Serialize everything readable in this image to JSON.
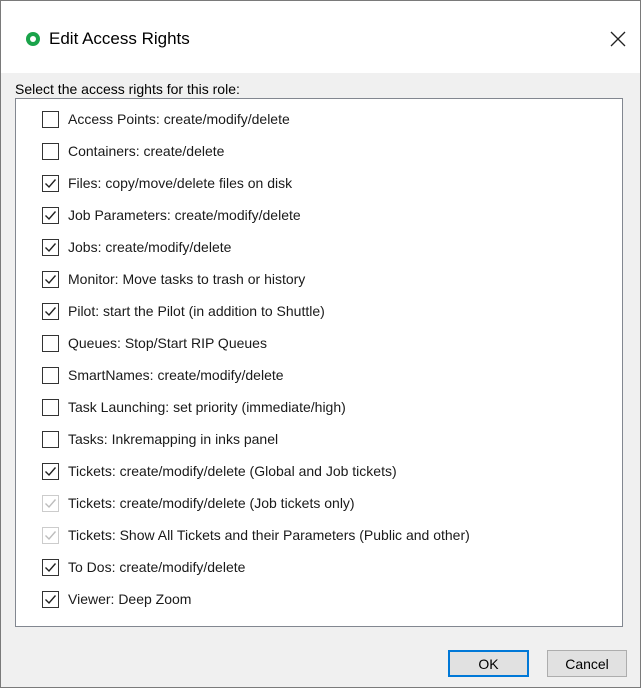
{
  "dialog": {
    "title": "Edit Access Rights",
    "icon": "app-circle-icon",
    "close": "close-icon"
  },
  "prompt": "Select the access rights for this role:",
  "rights": [
    {
      "label": "Access Points: create/modify/delete",
      "checked": false,
      "enabled": true
    },
    {
      "label": "Containers: create/delete",
      "checked": false,
      "enabled": true
    },
    {
      "label": "Files: copy/move/delete files on disk",
      "checked": true,
      "enabled": true
    },
    {
      "label": "Job Parameters: create/modify/delete",
      "checked": true,
      "enabled": true
    },
    {
      "label": "Jobs: create/modify/delete",
      "checked": true,
      "enabled": true
    },
    {
      "label": "Monitor: Move tasks to trash or history",
      "checked": true,
      "enabled": true
    },
    {
      "label": "Pilot: start the Pilot (in addition to Shuttle)",
      "checked": true,
      "enabled": true
    },
    {
      "label": "Queues: Stop/Start RIP Queues",
      "checked": false,
      "enabled": true
    },
    {
      "label": "SmartNames: create/modify/delete",
      "checked": false,
      "enabled": true
    },
    {
      "label": "Task Launching: set priority (immediate/high)",
      "checked": false,
      "enabled": true
    },
    {
      "label": "Tasks: Inkremapping in inks panel",
      "checked": false,
      "enabled": true
    },
    {
      "label": "Tickets: create/modify/delete (Global and Job tickets)",
      "checked": true,
      "enabled": true
    },
    {
      "label": "Tickets: create/modify/delete (Job tickets only)",
      "checked": true,
      "enabled": false
    },
    {
      "label": "Tickets: Show All Tickets and their Parameters (Public and other)",
      "checked": true,
      "enabled": false
    },
    {
      "label": "To Dos: create/modify/delete",
      "checked": true,
      "enabled": true
    },
    {
      "label": "Viewer: Deep Zoom",
      "checked": true,
      "enabled": true
    }
  ],
  "buttons": {
    "ok": "OK",
    "cancel": "Cancel"
  },
  "colors": {
    "accent": "#0078d7",
    "app_icon": "#1aa34a"
  }
}
